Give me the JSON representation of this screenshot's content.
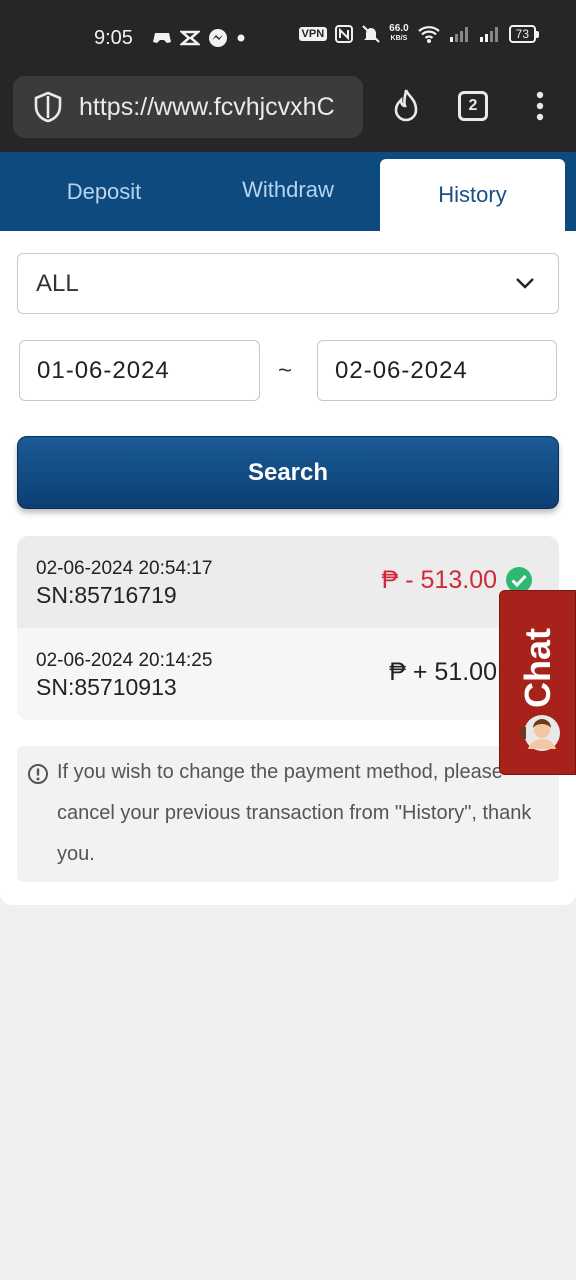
{
  "status_bar": {
    "time": "9:05",
    "vpn": "VPN",
    "speed_value": "66.0",
    "speed_unit": "KB/S",
    "battery": "73"
  },
  "browser": {
    "url": "https://www.fcvhjcvxhC",
    "tab_count": "2"
  },
  "tabs": [
    {
      "label": "Deposit",
      "active": false
    },
    {
      "label": "Withdraw",
      "active": false
    },
    {
      "label": "History",
      "active": true
    }
  ],
  "filter": {
    "type_value": "ALL",
    "date_from": "01-06-2024",
    "date_separator": "~",
    "date_to": "02-06-2024",
    "search_label": "Search"
  },
  "history": [
    {
      "datetime": "02-06-2024 20:54:17",
      "sn": "SN:85716719",
      "amount": "₱ - 513.00",
      "status": "success",
      "color": "#d0293c"
    },
    {
      "datetime": "02-06-2024 20:14:25",
      "sn": "SN:85710913",
      "amount": "₱ + 51.00",
      "color": "#222222"
    }
  ],
  "notice": {
    "text": "If you wish to change the payment method, please cancel your previous transaction from \"History\", thank you."
  },
  "chat": {
    "label": "Chat"
  },
  "colors": {
    "brand": "#0d4a80",
    "negative": "#d0293c",
    "success": "#2eb872",
    "chat": "#a7221b"
  }
}
